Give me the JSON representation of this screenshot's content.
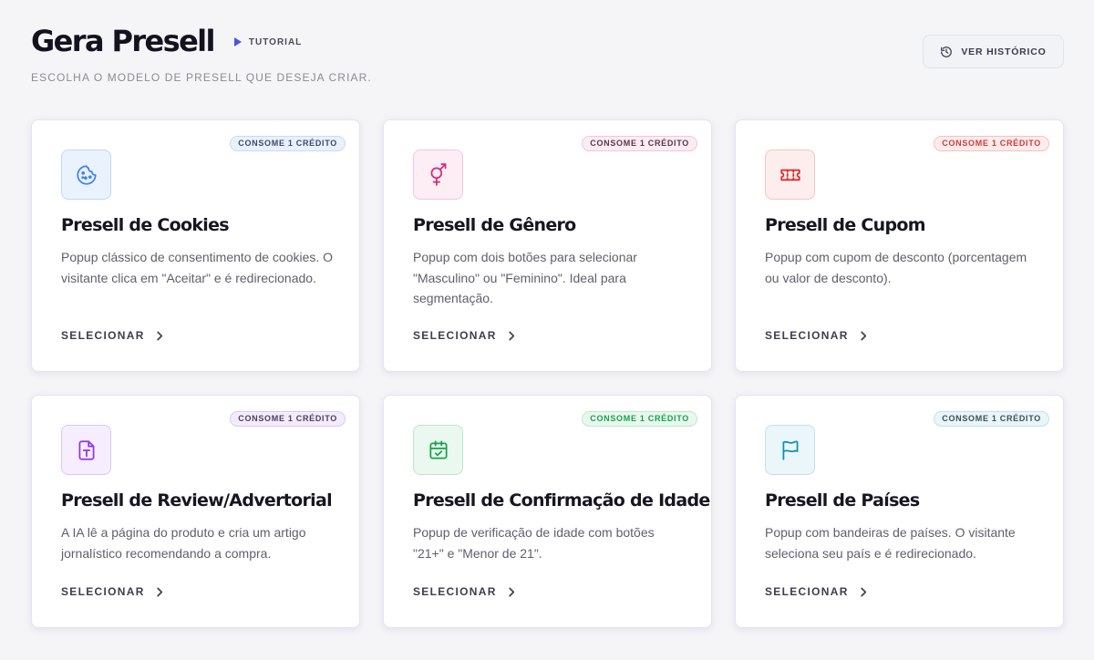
{
  "header": {
    "title": "Gera Presell",
    "tutorial_label": "TUTORIAL",
    "subtitle": "ESCOLHA O MODELO DE PRESELL QUE DESEJA CRIAR.",
    "history_label": "VER HISTÓRICO"
  },
  "cards": [
    {
      "badge": "CONSOME 1 CRÉDITO",
      "title": "Presell de Cookies",
      "description": "Popup clássico de consentimento de cookies. O visitante clica em \"Aceitar\" e é redirecionado.",
      "select_label": "SELECIONAR",
      "icon": "cookie-icon",
      "accent": "#3b82f6"
    },
    {
      "badge": "CONSOME 1 CRÉDITO",
      "title": "Presell de Gênero",
      "description": "Popup com dois botões para selecionar \"Masculino\" ou \"Feminino\". Ideal para segmentação.",
      "select_label": "SELECIONAR",
      "icon": "gender-icon",
      "accent": "#db2777"
    },
    {
      "badge": "CONSOME 1 CRÉDITO",
      "title": "Presell de Cupom",
      "description": "Popup com cupom de desconto (porcentagem ou valor de desconto).",
      "select_label": "SELECIONAR",
      "icon": "ticket-icon",
      "accent": "#dc2626"
    },
    {
      "badge": "CONSOME 1 CRÉDITO",
      "title": "Presell de Review/Advertorial",
      "description": "A IA lê a página do produto e cria um artigo jornalístico recomendando a compra.",
      "select_label": "SELECIONAR",
      "icon": "document-text-icon",
      "accent": "#9333ea"
    },
    {
      "badge": "CONSOME 1 CRÉDITO",
      "title": "Presell de Confirmação de Idade",
      "description": "Popup de verificação de idade com botões \"21+\" e \"Menor de 21\".",
      "select_label": "SELECIONAR",
      "icon": "calendar-check-icon",
      "accent": "#16a34a"
    },
    {
      "badge": "CONSOME 1 CRÉDITO",
      "title": "Presell de Países",
      "description": "Popup com bandeiras de países. O visitante seleciona seu país e é redirecionado.",
      "select_label": "SELECIONAR",
      "icon": "flag-icon",
      "accent": "#0891b2"
    }
  ]
}
